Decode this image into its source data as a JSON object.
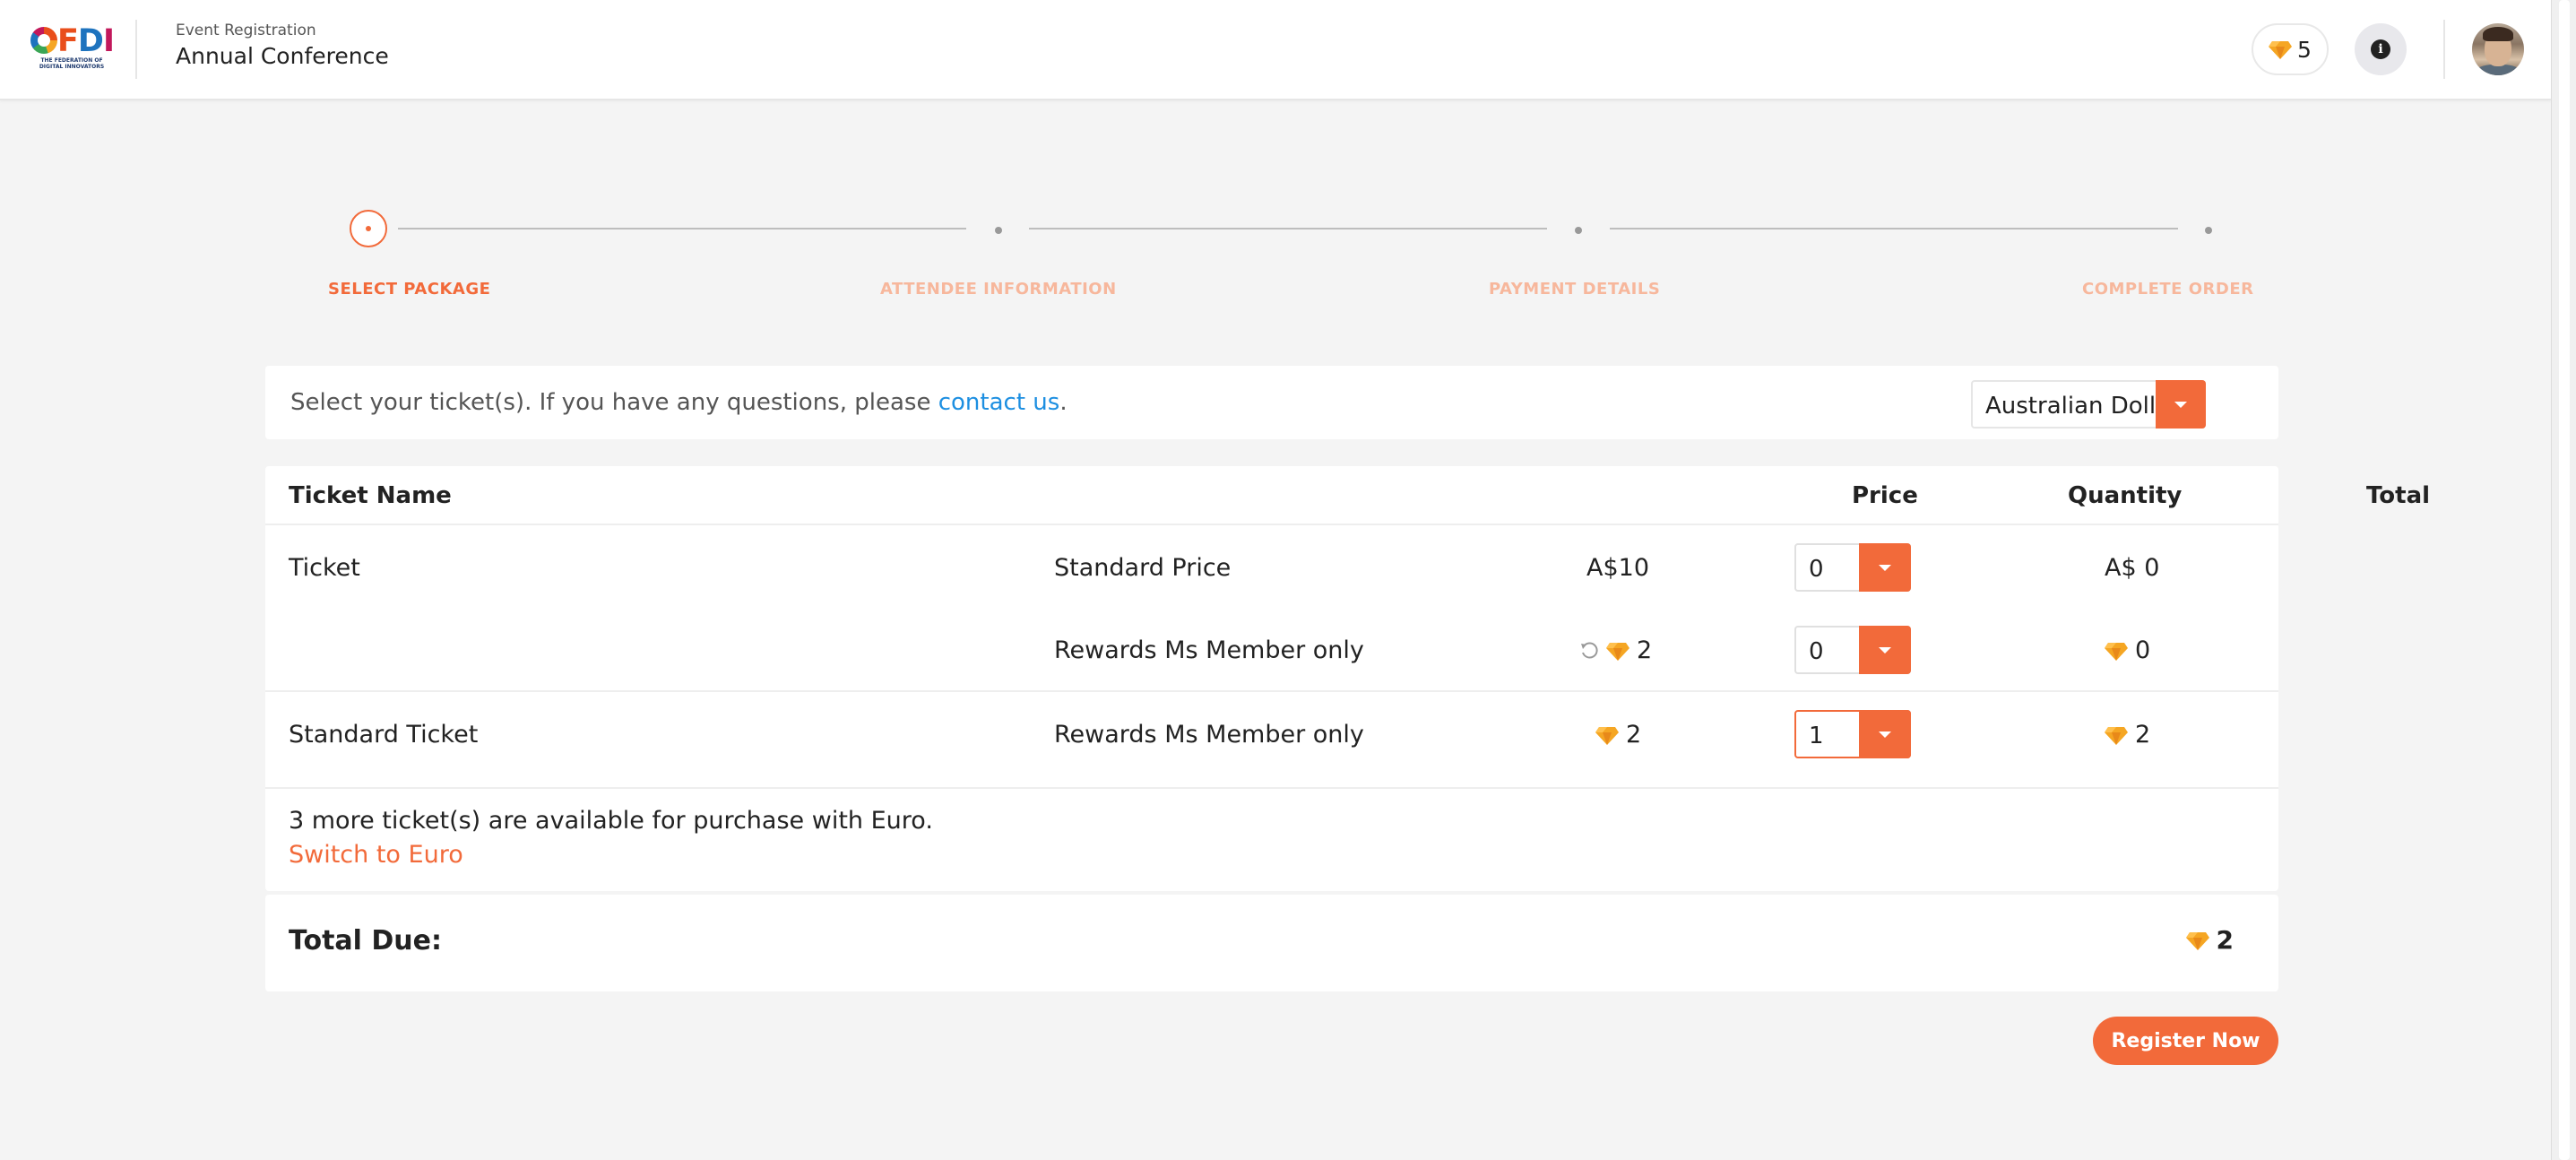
{
  "header": {
    "logo_text_f": "F",
    "logo_text_d": "D",
    "logo_text_i": "I",
    "logo_subtitle": "THE FEDERATION OF DIGITAL INNOVATORS",
    "breadcrumb_sub": "Event Registration",
    "breadcrumb_title": "Annual Conference",
    "points": "5"
  },
  "stepper": {
    "steps": [
      {
        "label": "SELECT PACKAGE",
        "state": "active"
      },
      {
        "label": "ATTENDEE INFORMATION",
        "state": "inactive"
      },
      {
        "label": "PAYMENT DETAILS",
        "state": "inactive"
      },
      {
        "label": "COMPLETE ORDER",
        "state": "inactive"
      }
    ]
  },
  "info_bar": {
    "text_before": "Select your ticket(s). If you have any questions, please ",
    "link": "contact us",
    "text_after": ".",
    "currency": "Australian Dollar"
  },
  "table": {
    "headers": {
      "name": "Ticket Name",
      "price": "Price",
      "quantity": "Quantity",
      "total": "Total"
    },
    "rows": [
      {
        "name": "Ticket",
        "type": "Standard Price",
        "price": "A$10",
        "quantity": "0",
        "total": "A$ 0"
      },
      {
        "name": "",
        "type": "Rewards Ms Member only",
        "price": "2",
        "quantity": "0",
        "total": "0"
      },
      {
        "name": "Standard Ticket",
        "type": "Rewards Ms Member only",
        "price": "2",
        "quantity": "1",
        "total": "2"
      }
    ],
    "note": "3 more ticket(s) are available for purchase with Euro.",
    "switch_link": "Switch to Euro"
  },
  "total_due": {
    "label": "Total Due:",
    "value": "2"
  },
  "register_button": "Register Now",
  "colors": {
    "accent": "#f26a3a",
    "link": "#1d8fe1",
    "accent_light": "#f7b79c",
    "gem": "#f5a623"
  },
  "icons": {
    "points": "gem-icon",
    "info": "info-icon",
    "dropdown": "caret-down-icon",
    "refresh": "refresh-icon"
  }
}
